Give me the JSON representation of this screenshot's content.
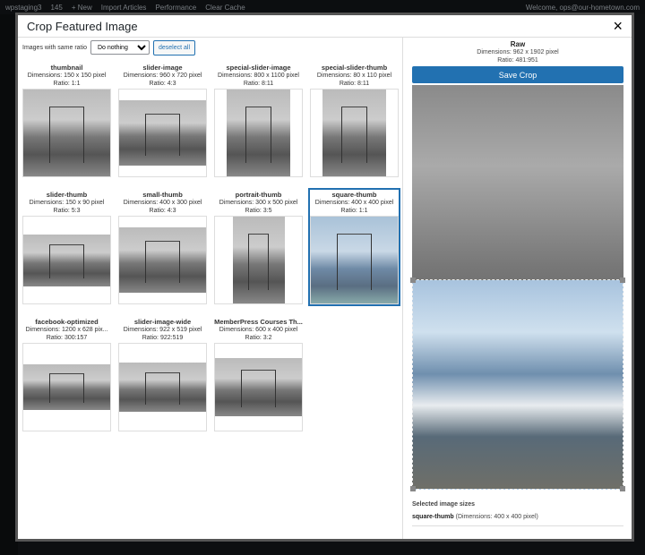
{
  "adminbar": {
    "site": "wpstaging3",
    "comments": "145",
    "new": "+ New",
    "import": "Import Articles",
    "performance": "Performance",
    "cache": "Clear Cache",
    "welcome": "Welcome, ops@our-hometown.com"
  },
  "modal": {
    "title": "Crop Featured Image",
    "close": "×"
  },
  "toolbar": {
    "label": "Images with same ratio",
    "select_value": "Do nothing",
    "deselect": "deselect all"
  },
  "sizes": [
    {
      "name": "thumbnail",
      "dims": "Dimensions: 150 x 150 pixel",
      "ratio": "Ratio: 1:1"
    },
    {
      "name": "slider-image",
      "dims": "Dimensions: 960 x 720 pixel",
      "ratio": "Ratio: 4:3"
    },
    {
      "name": "special-slider-image",
      "dims": "Dimensions: 800 x 1100 pixel",
      "ratio": "Ratio: 8:11"
    },
    {
      "name": "special-slider-thumb",
      "dims": "Dimensions: 80 x 110 pixel",
      "ratio": "Ratio: 8:11"
    },
    {
      "name": "slider-thumb",
      "dims": "Dimensions: 150 x 90 pixel",
      "ratio": "Ratio: 5:3"
    },
    {
      "name": "small-thumb",
      "dims": "Dimensions: 400 x 300 pixel",
      "ratio": "Ratio: 4:3"
    },
    {
      "name": "portrait-thumb",
      "dims": "Dimensions: 300 x 500 pixel",
      "ratio": "Ratio: 3:5"
    },
    {
      "name": "square-thumb",
      "dims": "Dimensions: 400 x 400 pixel",
      "ratio": "Ratio: 1:1"
    },
    {
      "name": "facebook-optimized",
      "dims": "Dimensions: 1200 x 628 pix...",
      "ratio": "Ratio: 300:157"
    },
    {
      "name": "slider-image-wide",
      "dims": "Dimensions: 922 x 519 pixel",
      "ratio": "Ratio: 922:519"
    },
    {
      "name": "MemberPress Courses Th...",
      "dims": "Dimensions: 600 x 400 pixel",
      "ratio": "Ratio: 3:2"
    }
  ],
  "raw": {
    "title": "Raw",
    "dims": "Dimensions: 962 x 1902 pixel",
    "ratio": "Ratio: 481:951",
    "save": "Save Crop"
  },
  "selected": {
    "heading": "Selected image sizes",
    "name": "square-thumb",
    "dims": "(Dimensions: 400 x 400 pixel)"
  },
  "colors": {
    "accent": "#2271b1"
  }
}
